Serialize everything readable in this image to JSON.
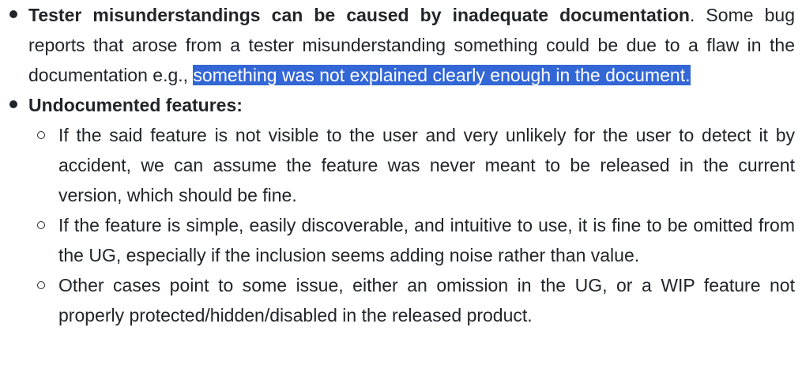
{
  "items": [
    {
      "bold": "Tester misunderstandings can be caused by inadequate documentation",
      "after_bold": ". Some bug reports that arose from a tester misunderstanding something could be due to a flaw in the documentation e.g., ",
      "highlighted": "something was not explained clearly enough in the document."
    },
    {
      "bold": "Undocumented features:",
      "subitems": [
        "If the said feature is not visible to the user and very unlikely for the user to detect it by accident, we can assume the feature was never meant to be released in the current version, which should be fine.",
        "If the feature is simple, easily discoverable, and intuitive to use, it is fine to be omitted from the UG, especially if the inclusion seems adding noise rather than value.",
        "Other cases point to some issue, either an omission in the UG, or a WIP feature not properly protected/hidden/disabled in the released product."
      ]
    }
  ],
  "colors": {
    "text": "#212529",
    "selection": "#3367d6",
    "selection_text": "#ffffff"
  }
}
